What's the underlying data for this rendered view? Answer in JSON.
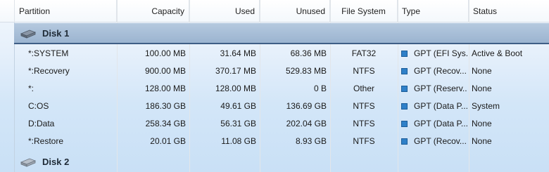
{
  "columns": {
    "partition": "Partition",
    "capacity": "Capacity",
    "used": "Used",
    "unused": "Unused",
    "filesystem": "File System",
    "type": "Type",
    "status": "Status"
  },
  "disks": [
    {
      "label": "Disk 1",
      "partitions": [
        {
          "name": "*:SYSTEM",
          "capacity": "100.00 MB",
          "used": "31.64 MB",
          "unused": "68.36 MB",
          "fs": "FAT32",
          "type": "GPT (EFI Sys...",
          "status": "Active & Boot"
        },
        {
          "name": "*:Recovery",
          "capacity": "900.00 MB",
          "used": "370.17 MB",
          "unused": "529.83 MB",
          "fs": "NTFS",
          "type": "GPT (Recov...",
          "status": "None"
        },
        {
          "name": "*:",
          "capacity": "128.00 MB",
          "used": "128.00 MB",
          "unused": "0 B",
          "fs": "Other",
          "type": "GPT (Reserv...",
          "status": "None"
        },
        {
          "name": "C:OS",
          "capacity": "186.30 GB",
          "used": "49.61 GB",
          "unused": "136.69 GB",
          "fs": "NTFS",
          "type": "GPT (Data P...",
          "status": "System"
        },
        {
          "name": "D:Data",
          "capacity": "258.34 GB",
          "used": "56.31 GB",
          "unused": "202.04 GB",
          "fs": "NTFS",
          "type": "GPT (Data P...",
          "status": "None"
        },
        {
          "name": "*:Restore",
          "capacity": "20.01 GB",
          "used": "11.08 GB",
          "unused": "8.93 GB",
          "fs": "NTFS",
          "type": "GPT (Recov...",
          "status": "None"
        }
      ]
    },
    {
      "label": "Disk 2",
      "partitions": []
    }
  ],
  "colors": {
    "type_marker": "#2f80c8",
    "selected_row": "#a9c0da"
  },
  "icons": {
    "disk": "hard-disk-icon",
    "partition_type": "partition-type-square-icon"
  }
}
